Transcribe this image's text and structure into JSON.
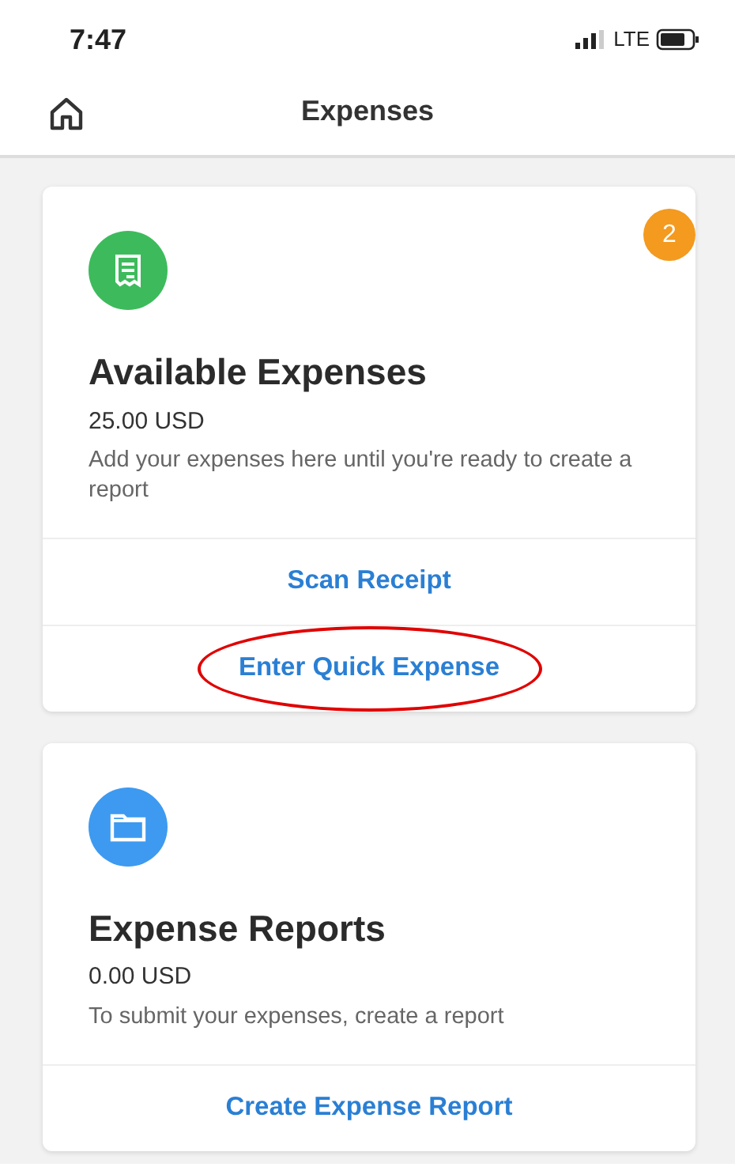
{
  "status_bar": {
    "time": "7:47",
    "network": "LTE"
  },
  "header": {
    "title": "Expenses"
  },
  "cards": [
    {
      "kind": "receipt",
      "color": "#3dbb5c",
      "badge": "2",
      "title": "Available Expenses",
      "amount": "25.00 USD",
      "description": "Add your expenses here until you're ready to create a report",
      "actions": [
        {
          "label": "Scan Receipt",
          "circled": false
        },
        {
          "label": "Enter Quick Expense",
          "circled": true
        }
      ]
    },
    {
      "kind": "folder",
      "color": "#3d9af0",
      "title": "Expense Reports",
      "amount": "0.00 USD",
      "description": "To submit your expenses, create a report",
      "actions": [
        {
          "label": "Create Expense Report",
          "circled": false
        }
      ]
    }
  ]
}
